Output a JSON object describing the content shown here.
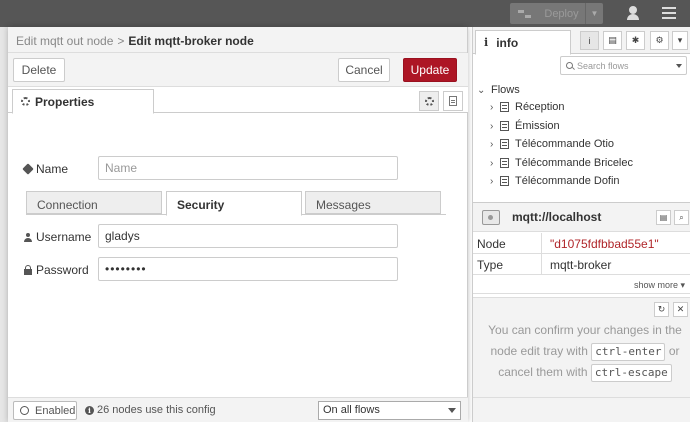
{
  "header": {
    "deploy_label": "Deploy"
  },
  "tray": {
    "breadcrumb": {
      "parent": "Edit mqtt out node",
      "separator": ">",
      "current": "Edit mqtt-broker node"
    },
    "toolbar": {
      "delete_label": "Delete",
      "cancel_label": "Cancel",
      "update_label": "Update",
      "update_color": "#ad1625"
    },
    "tabs": {
      "properties_label": "Properties"
    },
    "form": {
      "name_label": "Name",
      "name_value": "",
      "name_placeholder": "Name",
      "sub_tabs": [
        "Connection",
        "Security",
        "Messages"
      ],
      "active_sub_tab": "Security",
      "username_label": "Username",
      "username_value": "gladys",
      "password_label": "Password",
      "password_value": "••••••••"
    },
    "footer": {
      "enabled_label": "Enabled",
      "usage_text": "26 nodes use this config",
      "scope_value": "On all flows"
    }
  },
  "sidebar": {
    "tab_label": "info",
    "search_placeholder": "Search flows",
    "flows_label": "Flows",
    "flows": [
      "Réception",
      "Émission",
      "Télécommande Otio",
      "Télécommande Bricelec",
      "Télécommande Dofin"
    ],
    "node": {
      "title": "mqtt://localhost",
      "rows": [
        {
          "key": "Node",
          "value": "\"d1075fdfbbad55e1\""
        },
        {
          "key": "Type",
          "value": "mqtt-broker"
        }
      ],
      "show_more": "show more"
    },
    "help": {
      "line1": "You can confirm your changes in the node edit tray with",
      "key_confirm": "ctrl-enter",
      "line2": "or cancel them with",
      "key_cancel": "ctrl-escape"
    }
  }
}
